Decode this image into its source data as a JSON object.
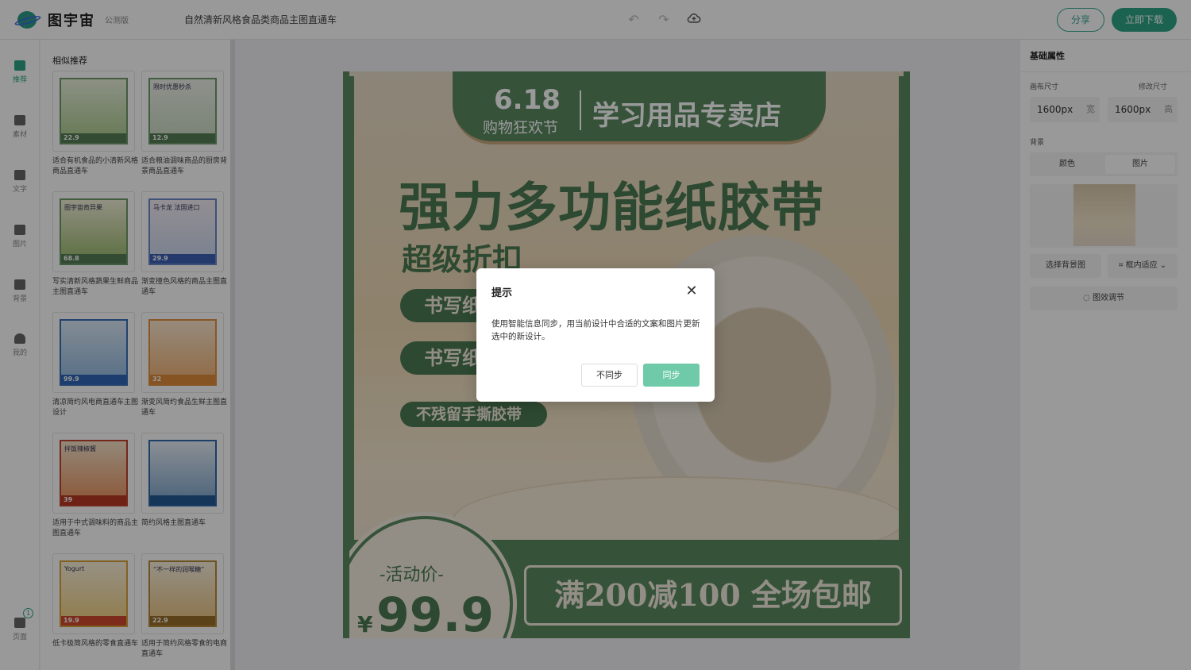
{
  "app": {
    "logo_text": "图宇宙",
    "beta_label": "公测版",
    "document_title": "自然清新风格食品类商品主图直通车",
    "share_label": "分享",
    "download_label": "立即下载"
  },
  "rail": {
    "items": [
      {
        "label": "推荐",
        "icon": "recommend-icon"
      },
      {
        "label": "素材",
        "icon": "material-icon"
      },
      {
        "label": "文字",
        "icon": "text-icon"
      },
      {
        "label": "图片",
        "icon": "image-icon"
      },
      {
        "label": "背景",
        "icon": "background-icon"
      },
      {
        "label": "我的",
        "icon": "user-icon"
      },
      {
        "label": "页面",
        "icon": "pages-icon"
      }
    ],
    "pages_badge": "1"
  },
  "left_panel": {
    "title": "相似推荐",
    "cards": [
      {
        "caption": "适合有机食品的小清新风格商品直通车",
        "price": "22.9",
        "tag": ""
      },
      {
        "caption": "适合粮油调味商品的厨房背景商品直通车",
        "price": "12.9",
        "tag": "限时优惠秒杀"
      },
      {
        "caption": "写实清新风格蔬果生鲜商品主图直通车",
        "price": "68.8",
        "tag": "图宇宙奇异果"
      },
      {
        "caption": "渐变撞色风格的商品主图直通车",
        "price": "29.9",
        "tag": "马卡龙 法国进口"
      },
      {
        "caption": "清凉简约风电商直通车主图设计",
        "price": "99.9",
        "tag": ""
      },
      {
        "caption": "渐变风简约食品生鲜主图直通车",
        "price": "32",
        "tag": ""
      },
      {
        "caption": "适用于中式调味料的商品主图直通车",
        "price": "39",
        "tag": "拌饭辣椒酱"
      },
      {
        "caption": "简约风格主图直通车",
        "price": "",
        "tag": ""
      },
      {
        "caption": "低卡极简风格的零食直通车",
        "price": "19.9",
        "tag": "Yogurt"
      },
      {
        "caption": "适用于简约风格零食的电商直通车",
        "price": "22.9",
        "tag": "“不一样的润喉糖”"
      }
    ]
  },
  "canvas": {
    "banner_date": "6.18",
    "banner_sub": "购物狂欢节",
    "banner_shop": "学习用品专卖店",
    "headline": "强力多功能纸胶带",
    "subhead": "超级折扣",
    "pill1": "书写纸",
    "pill2": "书写纸",
    "pill3": "不残留手撕胶带",
    "price_label": "-活动价-",
    "price_currency": "¥",
    "price_value": "99.9",
    "promo": "满200减100 全场包邮"
  },
  "right_panel": {
    "title": "基础属性",
    "canvas_size_label": "画布尺寸",
    "resize_link": "修改尺寸",
    "width_value": "1600px",
    "width_unit": "宽",
    "height_value": "1600px",
    "height_unit": "高",
    "background_label": "背景",
    "seg_color": "颜色",
    "seg_image": "图片",
    "choose_bg": "选择背景图",
    "fit_label": "框内适应",
    "effect_label": "图效调节"
  },
  "modal": {
    "title": "提示",
    "body": "使用智能信息同步，用当前设计中合适的文案和图片更新选中的新设计。",
    "cancel_label": "不同步",
    "confirm_label": "同步"
  },
  "colors": {
    "brand": "#2ea586",
    "sync_button": "#6ecaa9",
    "poster_green": "#5a8a62"
  }
}
